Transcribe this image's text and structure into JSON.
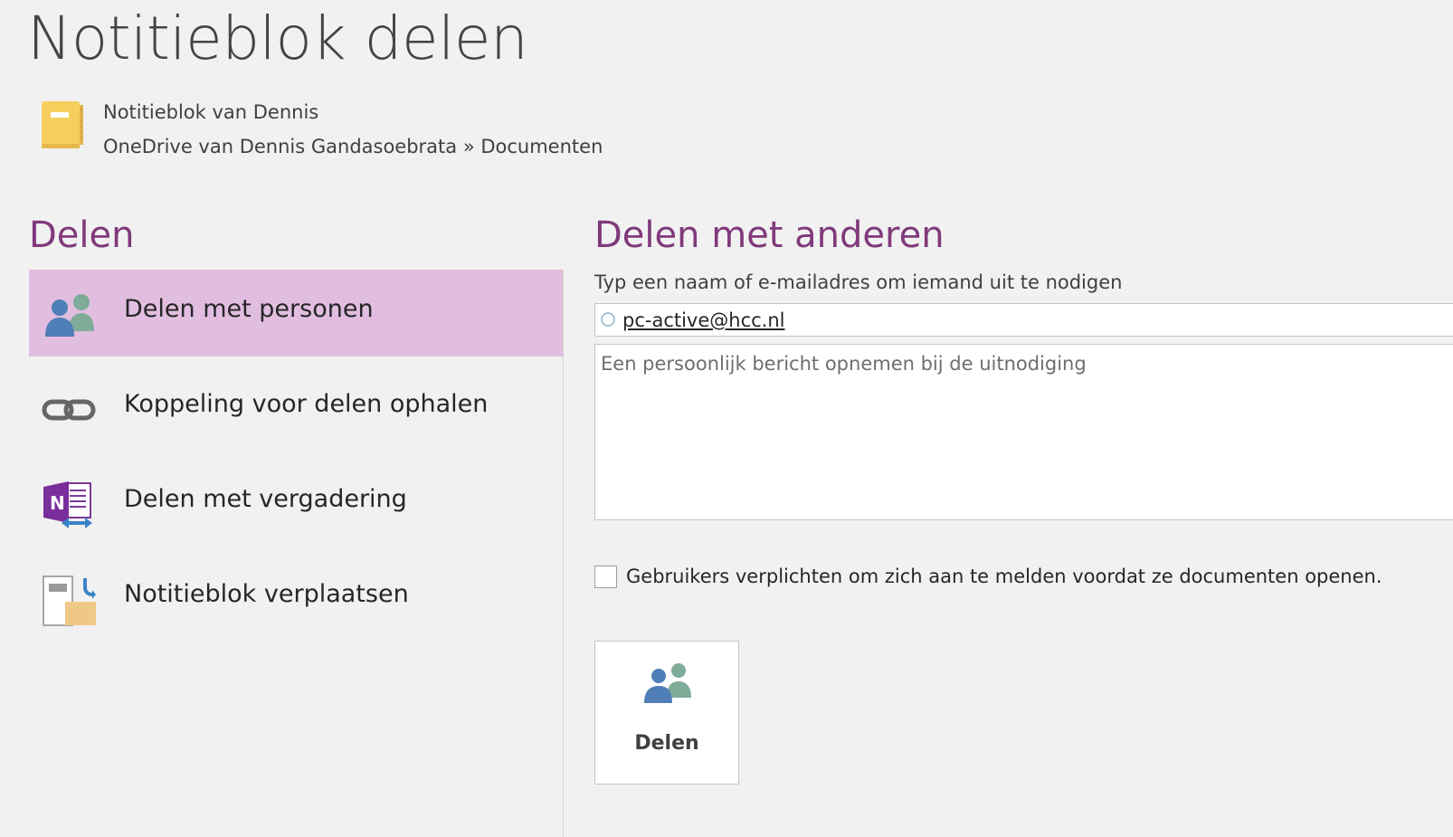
{
  "page": {
    "title": "Notitieblok delen"
  },
  "notebook": {
    "name": "Notitieblok van Dennis",
    "location": "OneDrive van Dennis Gandasoebrata » Documenten",
    "icon": "notebook-icon",
    "icon_color": "#f4cf5c"
  },
  "share_menu": {
    "heading": "Delen",
    "items": [
      {
        "label": "Delen met personen",
        "icon": "share-people-icon",
        "selected": true
      },
      {
        "label": "Koppeling voor delen ophalen",
        "icon": "link-icon",
        "selected": false
      },
      {
        "label": "Delen met vergadering",
        "icon": "onenote-meeting-icon",
        "selected": false
      },
      {
        "label": "Notitieblok verplaatsen",
        "icon": "move-notebook-icon",
        "selected": false
      }
    ]
  },
  "share_panel": {
    "heading": "Delen met anderen",
    "invite_label": "Typ een naam of e-mailadres om iemand uit te nodigen",
    "invite_value": "pc-active@hcc.nl",
    "message_placeholder": "Een persoonlijk bericht opnemen bij de uitnodiging",
    "require_signin_label": "Gebruikers verplichten om zich aan te melden voordat ze documenten openen.",
    "require_signin_checked": false,
    "share_button_label": "Delen"
  },
  "colors": {
    "accent": "#80397b",
    "selected_background": "#e1bee0",
    "background": "#f1f1f1"
  }
}
